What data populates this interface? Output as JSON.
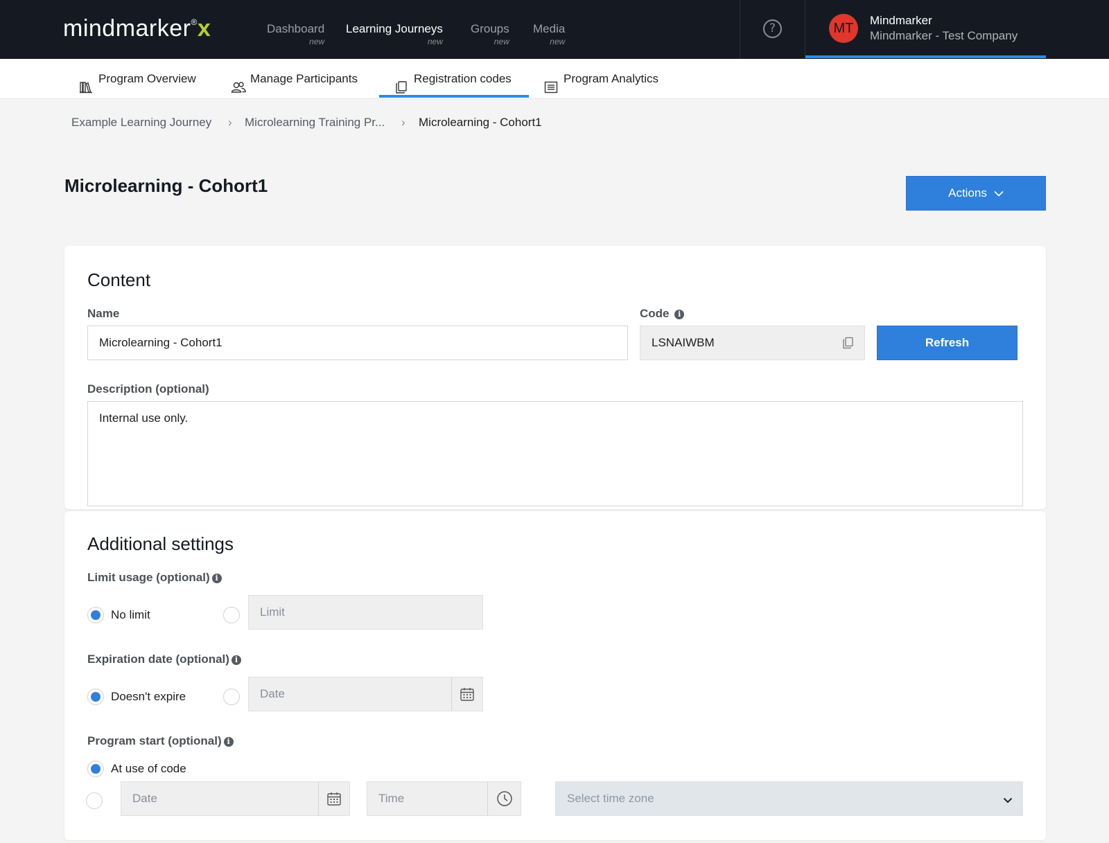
{
  "brand": {
    "logo_text": "mindmarker",
    "logo_reg": "®",
    "logo_x": "x"
  },
  "nav": [
    {
      "label": "Dashboard",
      "sub": "new"
    },
    {
      "label": "Learning Journeys",
      "sub": "new"
    },
    {
      "label": "Groups",
      "sub": "new"
    },
    {
      "label": "Media",
      "sub": "new"
    }
  ],
  "help": {
    "glyph": "?"
  },
  "user": {
    "initials": "MT",
    "name": "Mindmarker",
    "company": "Mindmarker - Test Company"
  },
  "subtabs": [
    {
      "label": "Program Overview",
      "icon": "books-icon"
    },
    {
      "label": "Manage Participants",
      "icon": "users-icon"
    },
    {
      "label": "Registration codes",
      "icon": "copy-icon"
    },
    {
      "label": "Program Analytics",
      "icon": "list-icon"
    }
  ],
  "breadcrumb": [
    "Example Learning Journey",
    "Microlearning Training Pr...",
    "Microlearning - Cohort1"
  ],
  "breadcrumb_sep": "›",
  "page": {
    "title": "Microlearning - Cohort1",
    "actions_label": "Actions"
  },
  "content": {
    "title": "Content",
    "name_label": "Name",
    "name_value": "Microlearning - Cohort1",
    "code_label": "Code",
    "code_value": "LSNAIWBM",
    "refresh_label": "Refresh",
    "description_label": "Description (optional)",
    "description_value": "Internal use only."
  },
  "settings": {
    "title": "Additional settings",
    "limit_label": "Limit usage (optional)",
    "limit_option_none": "No limit",
    "limit_placeholder": "Limit",
    "expiration_label": "Expiration date (optional)",
    "expiration_option_none": "Doesn't expire",
    "date_placeholder": "Date",
    "start_label": "Program start (optional)",
    "start_option_code": "At use of code",
    "start_date_placeholder": "Date",
    "time_placeholder": "Time",
    "timezone_placeholder": "Select time zone"
  },
  "colors": {
    "accent": "#2f80dd",
    "topbar": "#151a22",
    "avatar": "#e0362c",
    "logo_x": "#b6cf2e"
  }
}
